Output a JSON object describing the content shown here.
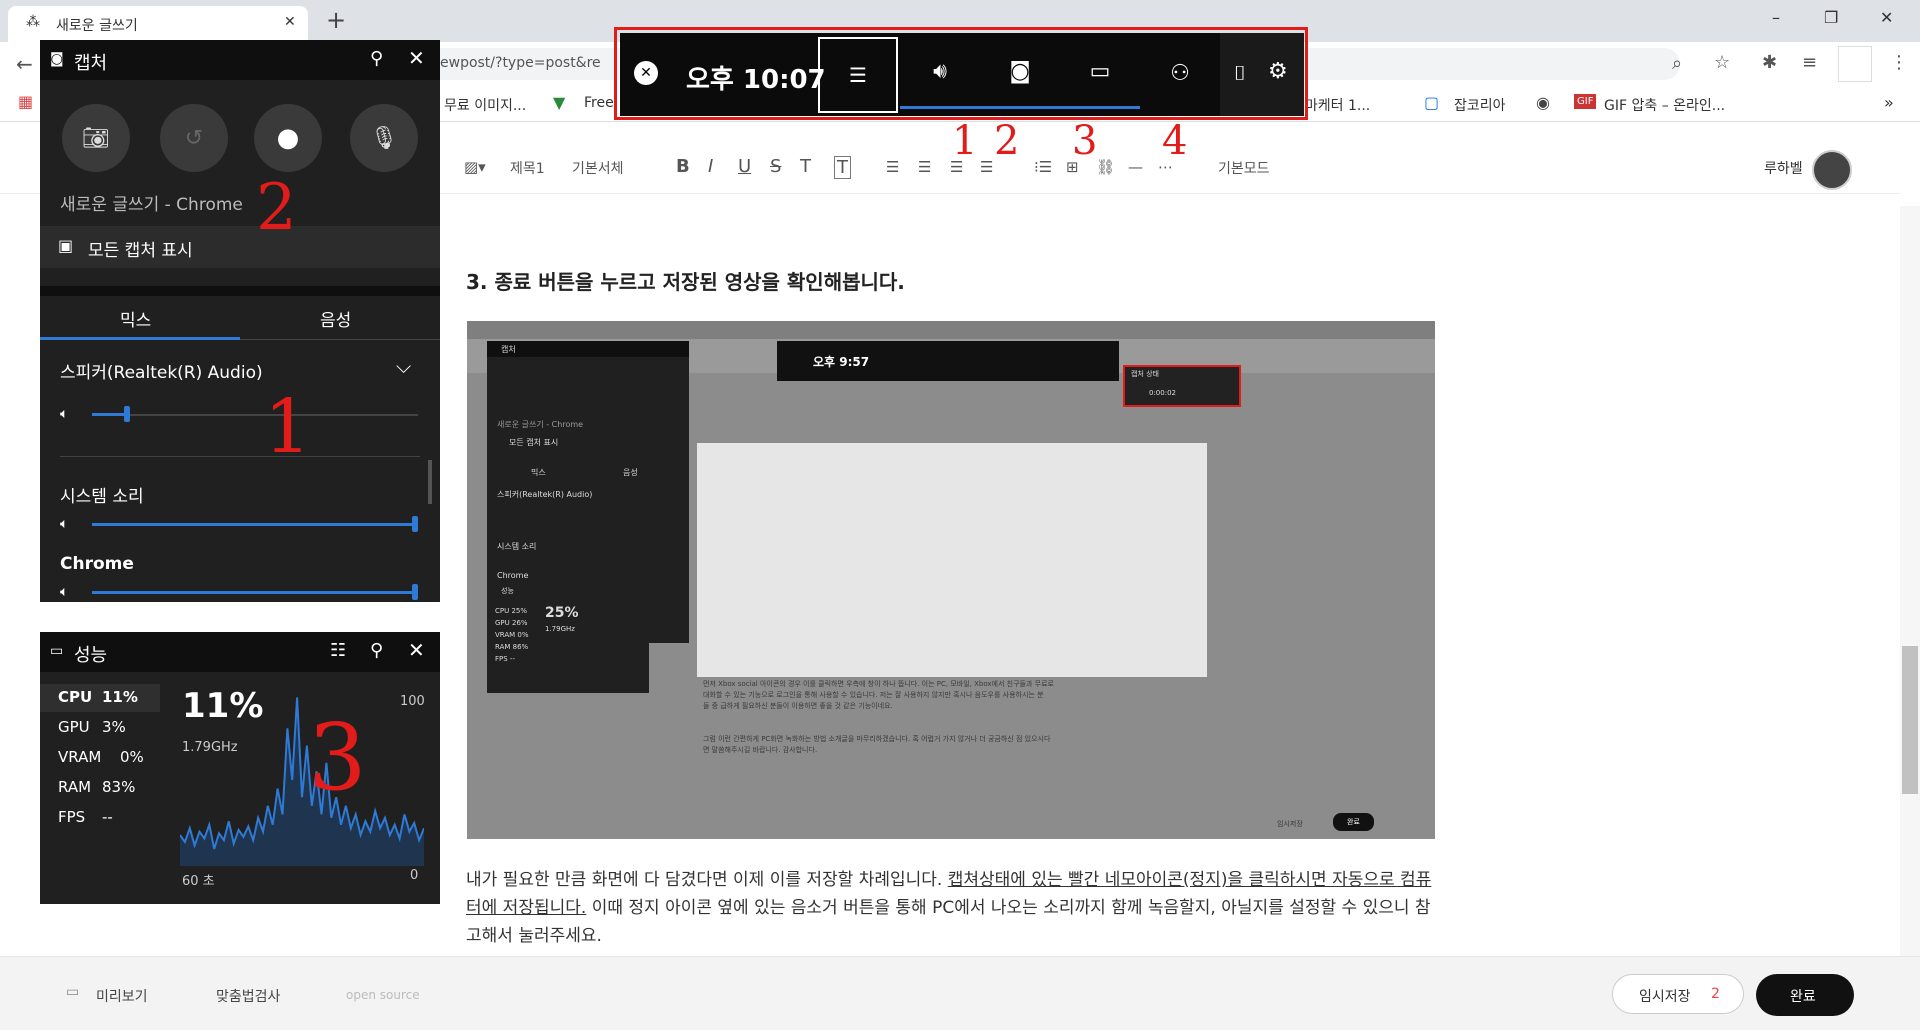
{
  "browser": {
    "tab_title": "새로운 글쓰기",
    "new_tab": "+",
    "url_fragment": "ewpost/?type=post&re",
    "bookmarks": [
      "무료 이미지...",
      "Free",
      "고마케터 1...",
      "잡코리아",
      "GIF 압축 – 온라인..."
    ],
    "bookmark_more": "»",
    "window_controls": [
      "–",
      "❐",
      "✕"
    ]
  },
  "editor": {
    "toolbar": [
      "제목1",
      "기본서체",
      "B",
      "I",
      "U",
      "S",
      "T",
      "T",
      "기본모드"
    ],
    "user": "루하벨",
    "heading": "3. 종료 버튼을 누르고 저장된 영상을 확인해봅니다.",
    "para_plain1": "내가 필요한 만큼 화면에 다 담겼다면 이제 이를 저장할 차례입니다. ",
    "para_underlined": "캡쳐상태에 있는 빨간 네모아이콘(정지)을 클릭하시면 자동으로 컴퓨터에 저장됩니다.",
    "para_plain2": " 이때 정지 아이콘 옆에 있는 음소거 버튼을 통해 PC에서 나오는 소리까지 함께 녹음할지, 아닐지를 설정할 수 있으니 참고해서 눌러주세요.",
    "bottom": {
      "preview": "미리보기",
      "spellcheck": "맞춤법검사",
      "opensource": "open source",
      "temp_save": "임시저장",
      "temp_count": "2",
      "done": "완료"
    }
  },
  "gamebar": {
    "time": "오후 10:07",
    "annotations": [
      "1",
      "2",
      "3",
      "4"
    ]
  },
  "capture": {
    "title": "캡처",
    "source": "새로운 글쓰기 - Chrome",
    "show_all": "모든 캡처 표시",
    "tabs": [
      "믹스",
      "음성"
    ],
    "speaker": "스피커(Realtek(R) Audio)",
    "system_sound": "시스템 소리",
    "chrome": "Chrome",
    "speaker_level": 0.1,
    "system_level": 1.0,
    "chrome_level": 1.0,
    "anno_2": "2",
    "anno_1": "1"
  },
  "performance": {
    "title": "성능",
    "rows": [
      {
        "label": "CPU",
        "value": "11%"
      },
      {
        "label": "GPU",
        "value": "3%"
      },
      {
        "label": "VRAM",
        "value": "0%"
      },
      {
        "label": "RAM",
        "value": "83%"
      },
      {
        "label": "FPS",
        "value": "--"
      }
    ],
    "big": "11%",
    "freq": "1.79GHz",
    "ymax": "100",
    "ymin": "0",
    "xlabel": "60 초",
    "anno_3": "3",
    "series": [
      18,
      14,
      22,
      12,
      20,
      16,
      24,
      10,
      19,
      15,
      26,
      13,
      21,
      17,
      23,
      15,
      28,
      20,
      35,
      24,
      45,
      30,
      80,
      50,
      98,
      40,
      70,
      35,
      55,
      30,
      60,
      28,
      40,
      24,
      35,
      22,
      30,
      18,
      26,
      20,
      32,
      22,
      28,
      18,
      24,
      16,
      30,
      20,
      25,
      15,
      22
    ]
  },
  "screenshot": {
    "time": "오후 9:57",
    "capture_title": "캡처",
    "source": "새로운 글쓰기 - Chrome",
    "show_all": "모든 캡처 표시",
    "tabs": [
      "믹스",
      "음성"
    ],
    "speaker": "스피커(Realtek(R) Audio)",
    "system_sound": "시스템 소리",
    "chrome": "Chrome",
    "perf_title": "성능",
    "rows": [
      "CPU 25%",
      "GPU 26%",
      "VRAM 0%",
      "RAM 86%",
      "FPS --"
    ],
    "big": "25%",
    "freq": "1.79GHz",
    "state_title": "캡처 상태",
    "timer": "0:00:02",
    "body1": "먼저 Xbox social 아이콘의 경우 이를 클릭하면 우측에 창이 하나 뜹니다. 이는 PC, 모바일, Xbox에서 친구들과 무료로",
    "body2": "대화할 수 있는 기능으로 로그인을 통해 사용할 수 있습니다. 저는 잘 사용하지 않지만 혹시나 음도우를 사용하시는 분",
    "body3": "들 중 급하게 필요하신 분들이 이용하면 좋을 것 같은 기능이네요.",
    "body4": "그럼 이런 간편하게 PC화면 녹화하는 방법 소개글을 마무리하겠습니다. 혹 어렵거 가지 않거나 더 궁금하신 점 있으시다",
    "body5": "면 말씀해주시길 바랍니다. 감사합니다.",
    "temp": "임시저장",
    "done": "완료"
  },
  "colors": {
    "accent": "#2f7ad6",
    "annotation": "#e21b1b"
  }
}
